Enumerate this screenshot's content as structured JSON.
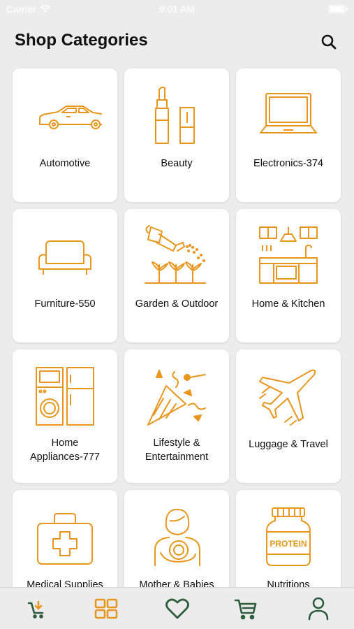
{
  "status_bar": {
    "carrier": "Carrier",
    "time": "9:01 AM"
  },
  "header": {
    "title": "Shop Categories",
    "search_icon": "search-icon"
  },
  "categories": [
    {
      "label": "Automotive",
      "icon": "car-icon"
    },
    {
      "label": "Beauty",
      "icon": "lipstick-icon"
    },
    {
      "label": "Electronics-374",
      "icon": "laptop-icon"
    },
    {
      "label": "Furniture-550",
      "icon": "sofa-icon"
    },
    {
      "label": "Garden & Outdoor",
      "icon": "watering-can-icon"
    },
    {
      "label": "Home & Kitchen",
      "icon": "kitchen-icon"
    },
    {
      "label_line1": "Home",
      "label_line2": "Appliances-777",
      "icon": "appliances-icon"
    },
    {
      "label_line1": "Lifestyle &",
      "label_line2": "Entertainment",
      "icon": "party-popper-icon"
    },
    {
      "label": "Luggage & Travel",
      "icon": "airplane-icon"
    },
    {
      "label": "Medical Supplies",
      "icon": "first-aid-kit-icon"
    },
    {
      "label": "Mother & Babies",
      "icon": "mother-baby-icon"
    },
    {
      "label": "Nutritions",
      "icon": "protein-jar-icon",
      "jar_text": "PROTEIN"
    }
  ],
  "tab_bar": [
    {
      "name": "shop",
      "icon": "cart-arrow-icon",
      "color": "#2e5d3f"
    },
    {
      "name": "categories",
      "icon": "grid-icon",
      "color": "#e8961e",
      "active": true
    },
    {
      "name": "wishlist",
      "icon": "heart-icon",
      "color": "#2e5d3f"
    },
    {
      "name": "cart",
      "icon": "cart-icon",
      "color": "#2e5d3f"
    },
    {
      "name": "profile",
      "icon": "user-icon",
      "color": "#2e5d3f"
    }
  ],
  "colors": {
    "accent": "#e8961e",
    "tab_inactive": "#2e5d3f",
    "background": "#ececec",
    "card": "#ffffff"
  }
}
